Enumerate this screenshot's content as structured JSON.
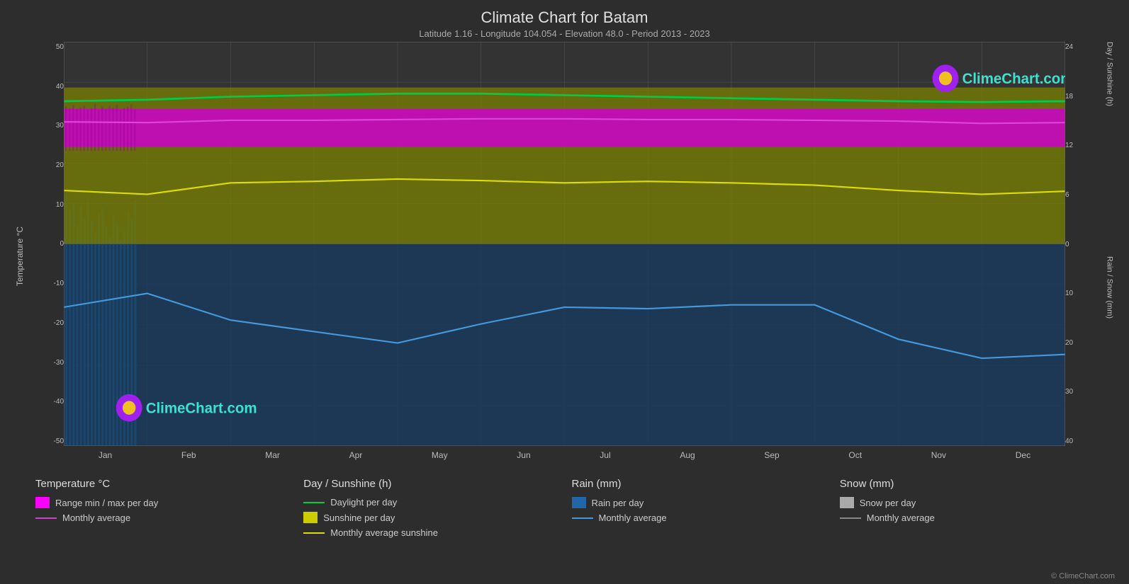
{
  "header": {
    "title": "Climate Chart for Batam",
    "subtitle": "Latitude 1.16 - Longitude 104.054 - Elevation 48.0 - Period 2013 - 2023"
  },
  "yaxis_left": {
    "label": "Temperature °C",
    "ticks": [
      "50",
      "40",
      "30",
      "20",
      "10",
      "0",
      "-10",
      "-20",
      "-30",
      "-40",
      "-50"
    ]
  },
  "yaxis_right_top": {
    "label": "Day / Sunshine (h)",
    "ticks": [
      "24",
      "18",
      "12",
      "6",
      "0"
    ]
  },
  "yaxis_right_bottom": {
    "label": "Rain / Snow (mm)",
    "ticks": [
      "0",
      "10",
      "20",
      "30",
      "40"
    ]
  },
  "xaxis": {
    "months": [
      "Jan",
      "Feb",
      "Mar",
      "Apr",
      "May",
      "Jun",
      "Jul",
      "Aug",
      "Sep",
      "Oct",
      "Nov",
      "Dec"
    ]
  },
  "legend": {
    "col1": {
      "title": "Temperature °C",
      "items": [
        {
          "type": "swatch",
          "color": "#ff00ff",
          "label": "Range min / max per day"
        },
        {
          "type": "line",
          "color": "#cc44cc",
          "label": "Monthly average"
        }
      ]
    },
    "col2": {
      "title": "Day / Sunshine (h)",
      "items": [
        {
          "type": "line",
          "color": "#00cc44",
          "label": "Daylight per day"
        },
        {
          "type": "swatch",
          "color": "#cccc00",
          "label": "Sunshine per day"
        },
        {
          "type": "line",
          "color": "#dddd00",
          "label": "Monthly average sunshine"
        }
      ]
    },
    "col3": {
      "title": "Rain (mm)",
      "items": [
        {
          "type": "swatch",
          "color": "#2266aa",
          "label": "Rain per day"
        },
        {
          "type": "line",
          "color": "#4499dd",
          "label": "Monthly average"
        }
      ]
    },
    "col4": {
      "title": "Snow (mm)",
      "items": [
        {
          "type": "swatch",
          "color": "#aaaaaa",
          "label": "Snow per day"
        },
        {
          "type": "line",
          "color": "#888888",
          "label": "Monthly average"
        }
      ]
    }
  },
  "logo": {
    "text": "ClimeChart.com"
  },
  "copyright": "© ClimeChart.com"
}
